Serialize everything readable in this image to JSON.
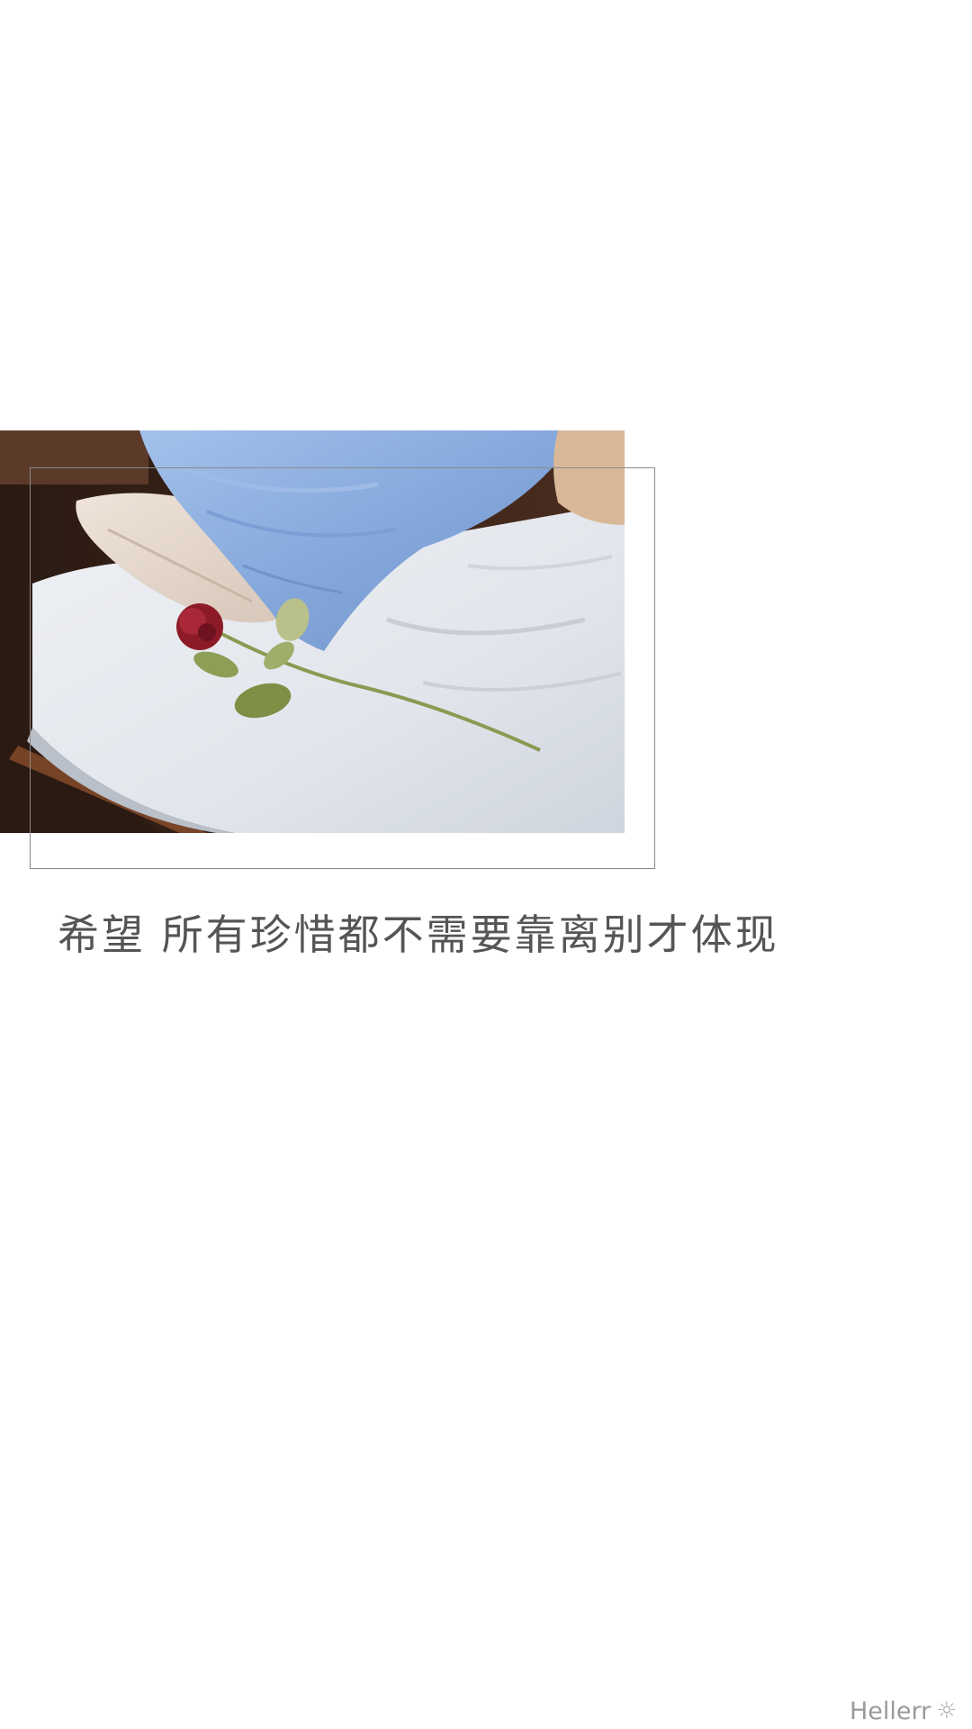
{
  "quote": {
    "text": "希望 所有珍惜都不需要靠离别才体现"
  },
  "watermark": {
    "text": "Hellerr",
    "icon": "sun-icon"
  },
  "photo": {
    "subject": "rose-on-bed-photo",
    "colors": {
      "pillow_blue": "#8fb2e2",
      "sheet": "#e8ebf0",
      "wood": "#3a2418",
      "rose": "#9a1e2a",
      "leaf": "#7d8f45"
    }
  }
}
